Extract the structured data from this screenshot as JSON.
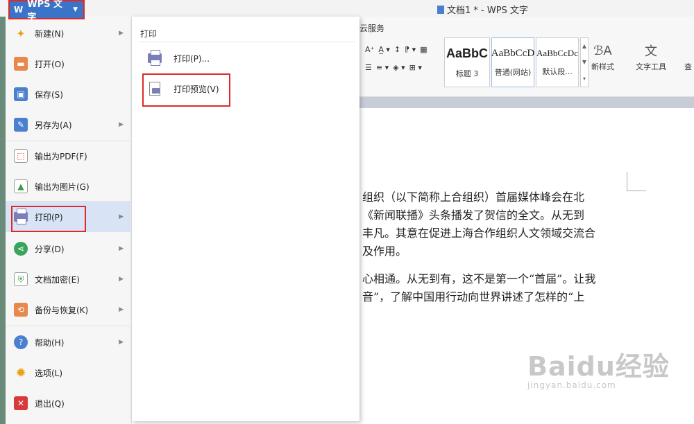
{
  "app": {
    "wps_button_label": "WPS 文字",
    "document_title": "文档1 * - WPS 文字"
  },
  "ribbon": {
    "tab_partial": "云服务",
    "styles": [
      {
        "sample": "AaBbC",
        "name": "标题 3"
      },
      {
        "sample": "AaBbCcD",
        "name": "普通(网站)"
      },
      {
        "sample": "AaBbCcDc",
        "name": "默认段..."
      }
    ],
    "new_style_label": "新样式",
    "text_tools_label": "文字工具",
    "find_partial": "查"
  },
  "menu": {
    "items": [
      {
        "label": "新建(N)",
        "icon": "new-doc-icon",
        "submenu": true
      },
      {
        "label": "打开(O)",
        "icon": "folder-icon",
        "submenu": false
      },
      {
        "label": "保存(S)",
        "icon": "save-icon",
        "submenu": false
      },
      {
        "label": "另存为(A)",
        "icon": "save-as-icon",
        "submenu": true
      },
      {
        "label": "输出为PDF(F)",
        "icon": "pdf-icon",
        "submenu": false
      },
      {
        "label": "输出为图片(G)",
        "icon": "image-icon",
        "submenu": false
      },
      {
        "label": "打印(P)",
        "icon": "printer-icon",
        "submenu": true,
        "active": true
      },
      {
        "label": "分享(D)",
        "icon": "share-icon",
        "submenu": true
      },
      {
        "label": "文档加密(E)",
        "icon": "lock-doc-icon",
        "submenu": true
      },
      {
        "label": "备份与恢复(K)",
        "icon": "backup-icon",
        "submenu": true
      },
      {
        "label": "帮助(H)",
        "icon": "help-icon",
        "submenu": true
      },
      {
        "label": "选项(L)",
        "icon": "gear-icon",
        "submenu": false
      },
      {
        "label": "退出(Q)",
        "icon": "close-icon",
        "submenu": false
      }
    ]
  },
  "print_panel": {
    "title": "打印",
    "items": [
      {
        "label": "打印(P)...",
        "icon": "printer-icon"
      },
      {
        "label": "打印预览(V)",
        "icon": "print-preview-icon"
      }
    ]
  },
  "document": {
    "paragraph1": [
      "组织（以下简称上合组织）首届媒体峰会在北",
      "《新闻联播》头条播发了贺信的全文。从无到",
      "丰凡。其意在促进上海合作组织人文领域交流合",
      "及作用。"
    ],
    "paragraph2": [
      "心相通。从无到有，这不是第一个“首届”。让我",
      "音”，了解中国用行动向世界讲述了怎样的“上"
    ]
  },
  "watermark": {
    "brand": "Baidu经验",
    "url": "jingyan.baidu.com"
  },
  "colors": {
    "wps_blue": "#3a74c9",
    "highlight_red": "#e02828",
    "active_row": "#d8e4f5"
  }
}
